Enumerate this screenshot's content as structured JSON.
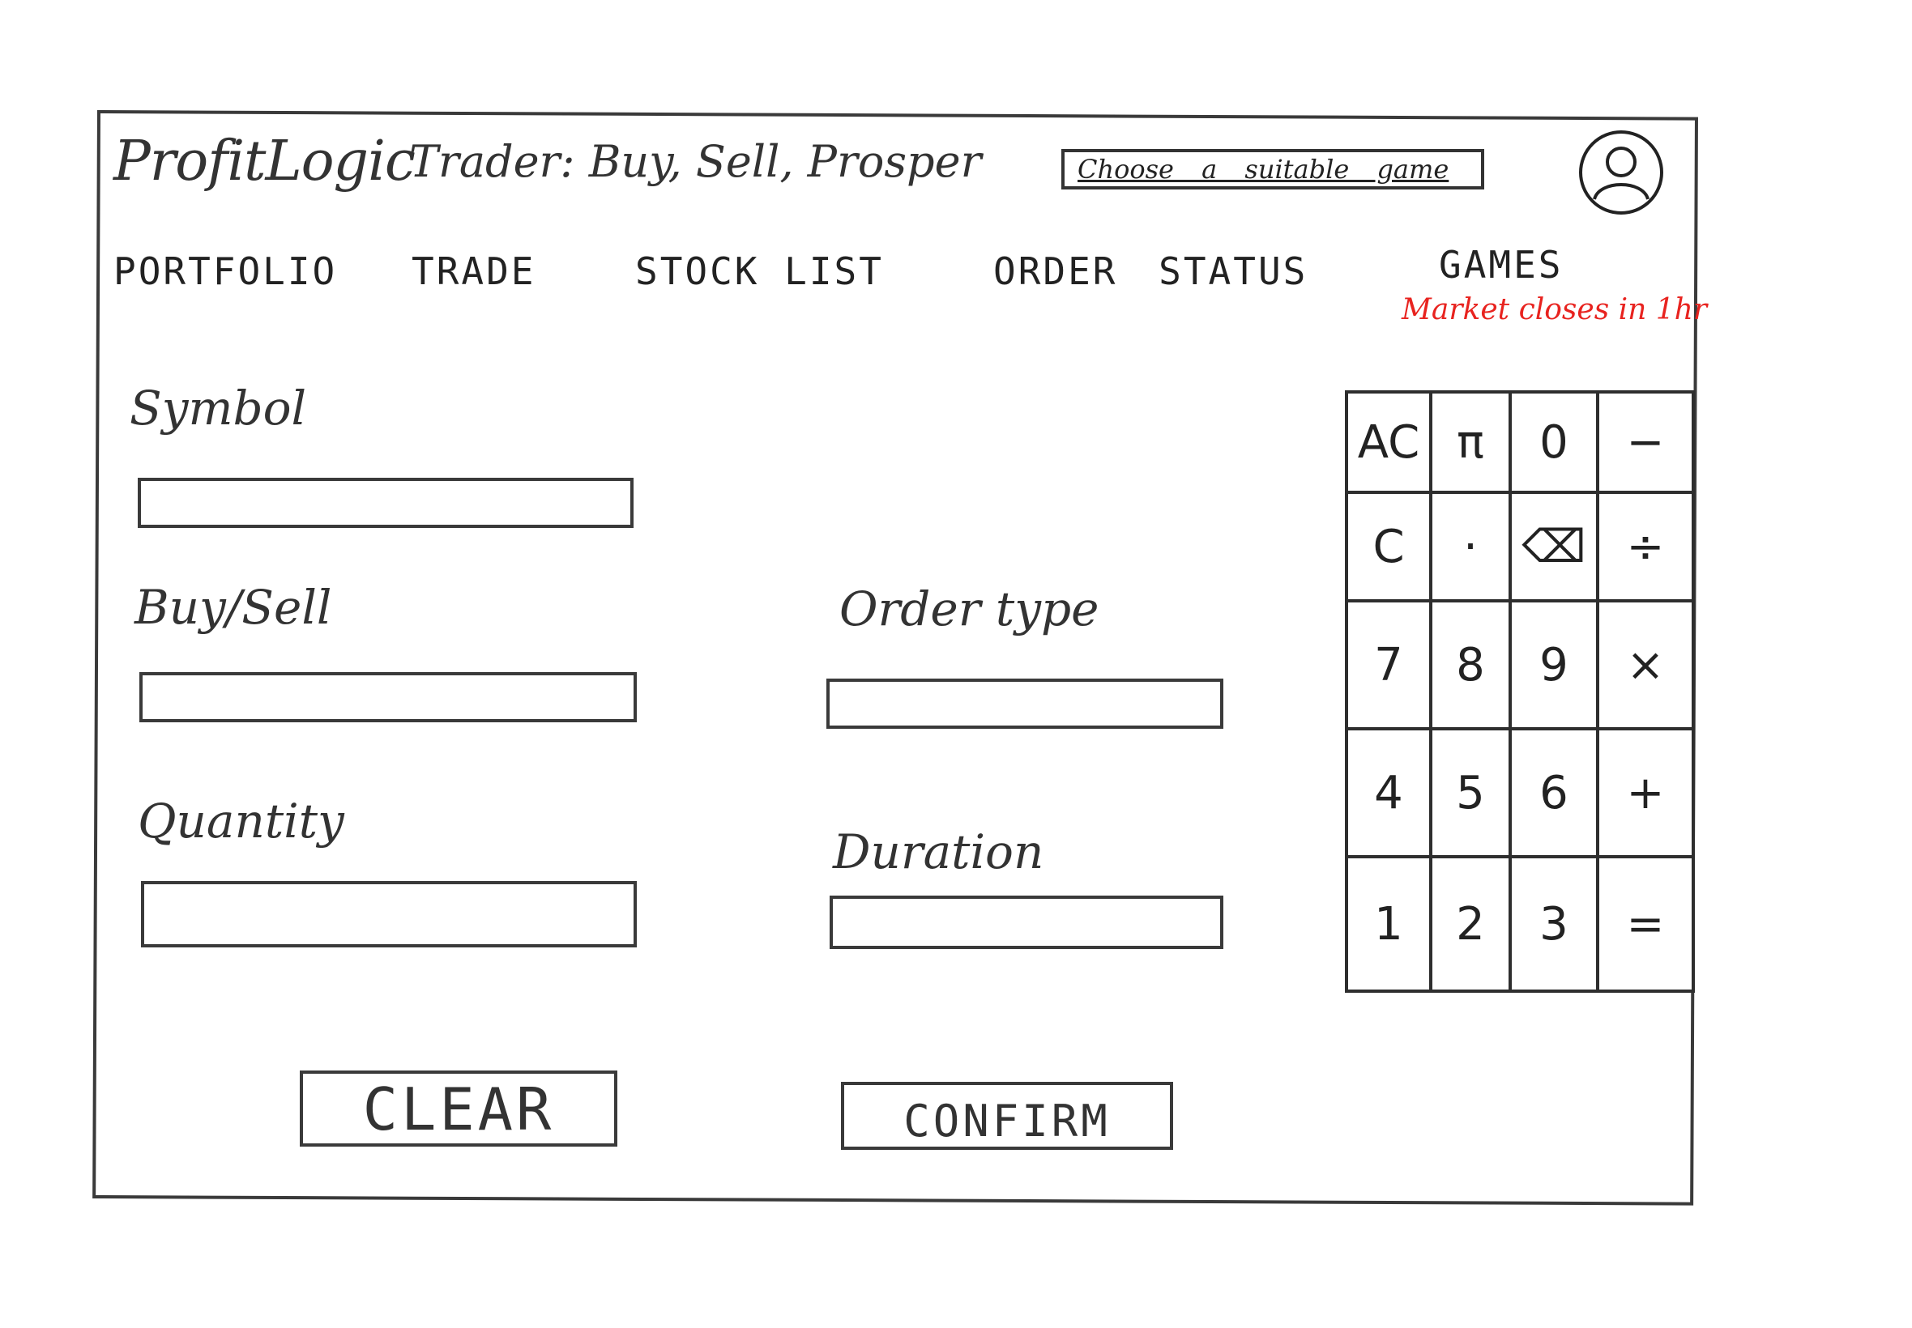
{
  "header": {
    "app_name": "ProfitLogic",
    "tagline": "Trader: Buy, Sell, Prosper",
    "game_select_label": "Choose a suitable game",
    "avatar_icon": "user-avatar-icon"
  },
  "nav": {
    "items": [
      {
        "label": "PORTFOLIO"
      },
      {
        "label": "TRADE"
      },
      {
        "label": "STOCK LIST"
      },
      {
        "label": "ORDER STATUS"
      },
      {
        "label": "GAMES"
      }
    ],
    "market_note": "Market closes in 1hr",
    "market_note_color": "#e8231f"
  },
  "form": {
    "symbol_label": "Symbol",
    "symbol_value": "",
    "buysell_label": "Buy/Sell",
    "buysell_value": "",
    "ordertype_label": "Order type",
    "ordertype_value": "",
    "quantity_label": "Quantity",
    "quantity_value": "",
    "duration_label": "Duration",
    "duration_value": "",
    "clear_label": "CLEAR",
    "confirm_label": "CONFIRM"
  },
  "calculator": {
    "keys": [
      "AC",
      "π",
      "0",
      "−",
      "C",
      "·",
      "⌫",
      "÷",
      "7",
      "8",
      "9",
      "×",
      "4",
      "5",
      "6",
      "+",
      "1",
      "2",
      "3",
      "="
    ]
  }
}
